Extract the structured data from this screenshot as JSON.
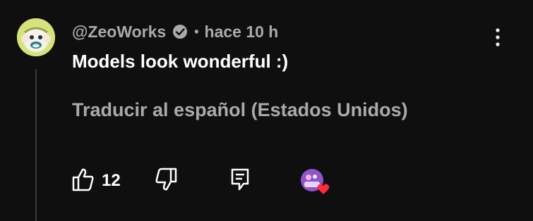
{
  "comment": {
    "author": "@ZeoWorks",
    "separator": "•",
    "time": "hace 10 h",
    "text": "Models look wonderful :)",
    "translate_label": "Traducir al español (Estados Unidos)",
    "like_count": "12"
  },
  "icons": {
    "avatar": "monkey-avatar",
    "verified": "verified-check-icon",
    "menu": "more-vertical-icon",
    "like": "thumbs-up-icon",
    "dislike": "thumbs-down-icon",
    "reply": "reply-comment-icon",
    "creator_heart": "creator-heart-icon"
  },
  "colors": {
    "background": "#0f0f0f",
    "primary_text": "#ffffff",
    "secondary_text": "#aaaaaa",
    "heart": "#ff2b3d"
  }
}
